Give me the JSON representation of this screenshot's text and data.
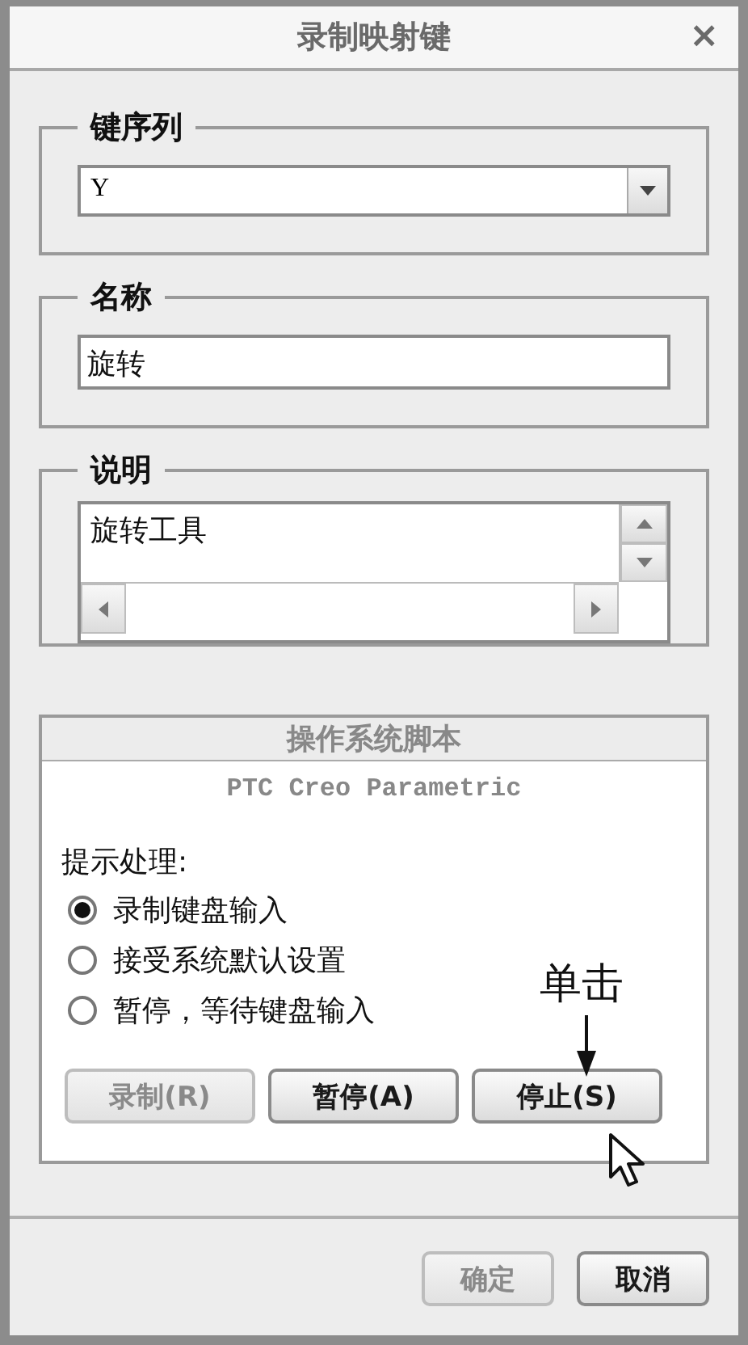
{
  "window": {
    "title": "录制映射键",
    "close": "×"
  },
  "key_sequence": {
    "label": "键序列",
    "value": "Y"
  },
  "name": {
    "label": "名称",
    "value": "旋转"
  },
  "description": {
    "label": "说明",
    "value": "旋转工具"
  },
  "script": {
    "title": "操作系统脚本",
    "title_disabled": true,
    "app_name": "PTC Creo Parametric",
    "prompt_label": "提示处理:",
    "options": [
      {
        "label": "录制键盘输入",
        "selected": true
      },
      {
        "label": "接受系统默认设置",
        "selected": false
      },
      {
        "label": "暂停，等待键盘输入",
        "selected": false
      }
    ],
    "buttons": [
      {
        "label": "录制(R)",
        "disabled": true
      },
      {
        "label": "暂停(A)",
        "disabled": false
      },
      {
        "label": "停止(S)",
        "disabled": false
      }
    ]
  },
  "footer_buttons": [
    {
      "label": "确定",
      "disabled": true
    },
    {
      "label": "取消",
      "disabled": false
    }
  ],
  "annotation": {
    "text": "单击"
  }
}
